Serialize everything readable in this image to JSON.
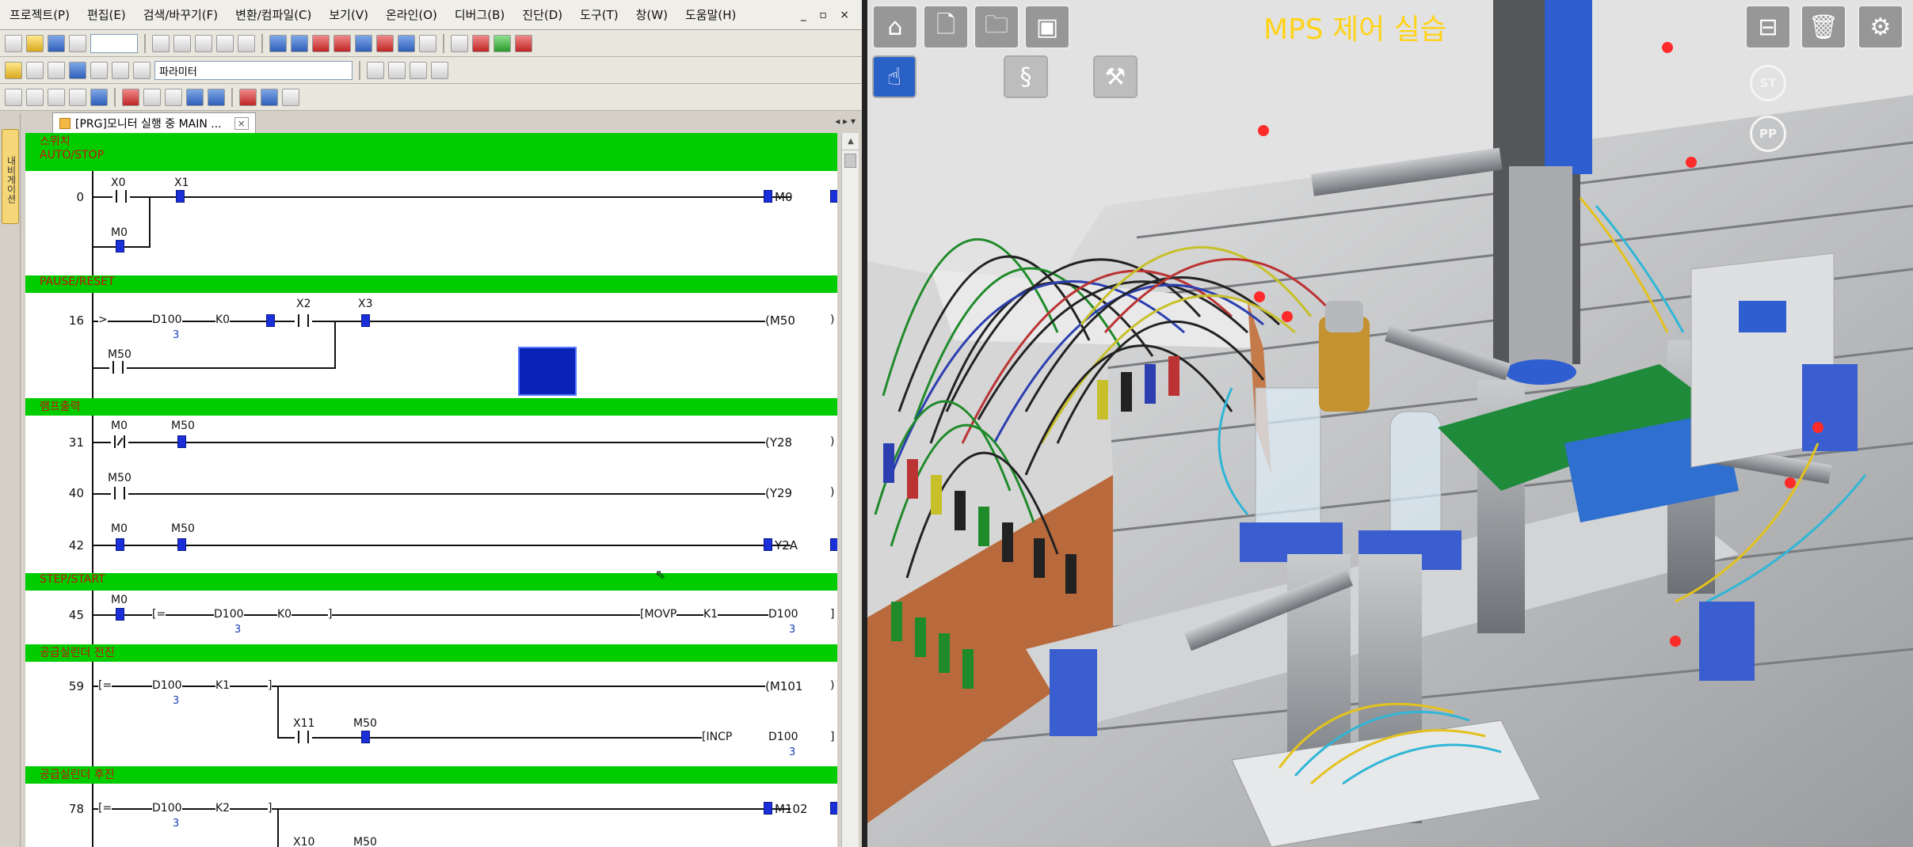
{
  "menu": [
    "프로젝트(P)",
    "편집(E)",
    "검색/바꾸기(F)",
    "변환/컴파일(C)",
    "보기(V)",
    "온라인(O)",
    "디버그(B)",
    "진단(D)",
    "도구(T)",
    "창(W)",
    "도움말(H)"
  ],
  "window_controls": "_ ▫ ×",
  "toolbar": {
    "param_combo": "파라미터"
  },
  "side_panel_tab": "내비게이션",
  "doc_tab": {
    "label": "[PRG]모니터 실행 중 MAIN ...",
    "close": "×",
    "nav": "◂ ▸ ▾"
  },
  "ladder": {
    "comments": [
      "스위치",
      "AUTO/STOP",
      "PAUSE/RESET",
      "램프출력",
      "STEP/START",
      "공급실린더 전진",
      "공급실린더 후진"
    ],
    "steps": [
      "0",
      "16",
      "31",
      "40",
      "42",
      "45",
      "59",
      "78"
    ],
    "r0": {
      "c1": "X0",
      "c2": "X1",
      "b1": "M0",
      "coil": "M0"
    },
    "r16": {
      "cmp": ">",
      "a": "D100",
      "a_val": "3",
      "b": "K0",
      "c1": "X2",
      "c2": "X3",
      "b1": "M50",
      "coil": "(M50"
    },
    "r31": {
      "c1": "M0",
      "c2": "M50",
      "coil": "(Y28"
    },
    "r40": {
      "c1": "M50",
      "coil": "(Y29"
    },
    "r42": {
      "c1": "M0",
      "c2": "M50",
      "coil": "Y2A"
    },
    "r45": {
      "c1": "M0",
      "cmp": "=",
      "a": "D100",
      "a_val": "3",
      "b": "K0",
      "inst": "MOVP",
      "k": "K1",
      "d": "D100",
      "d_val": "3"
    },
    "r59": {
      "cmp": "=",
      "a": "D100",
      "a_val": "3",
      "b": "K1",
      "coil": "(M101",
      "c1": "X11",
      "c2": "M50",
      "inst": "INCP",
      "d": "D100",
      "d_val": "3"
    },
    "r78": {
      "cmp": "=",
      "a": "D100",
      "a_val": "3",
      "b": "K2",
      "coil": "M102",
      "c1": "X10",
      "c2": "M50"
    }
  },
  "sim": {
    "title": "MPS 제어 실습",
    "btn_st": "ST",
    "btn_pp": "PP",
    "icons": [
      "home-icon",
      "document-icon",
      "folder-icon",
      "save-icon",
      "hand-pointer-icon",
      "wire-route-icon",
      "robot-arm-icon",
      "cylinder-icon",
      "trash-icon",
      "gear-icon"
    ]
  },
  "colors": {
    "rung_comment_bg": "#00cc00",
    "comment_text": "#c8110f",
    "contact_on": "#1a2fd8",
    "title_yellow": "#ffd319"
  }
}
